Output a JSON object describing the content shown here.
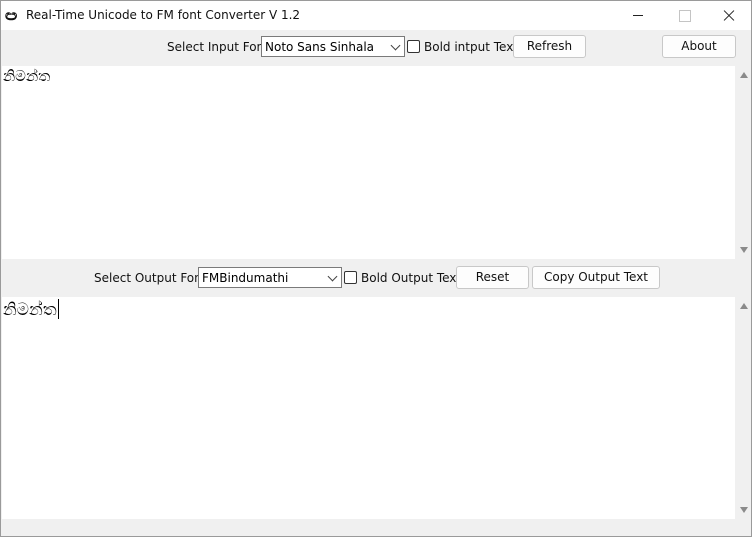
{
  "window": {
    "title": "Real-Time Unicode to FM font Converter V 1.2",
    "icon_glyph": "ඏ"
  },
  "input_bar": {
    "font_label": "Select Input Font",
    "font_selected": "Noto Sans Sinhala",
    "bold_label": "Bold intput Text",
    "bold_checked": false,
    "refresh_label": "Refresh",
    "about_label": "About"
  },
  "input_text": "නිමන්ත",
  "output_bar": {
    "font_label": "Select Output Font",
    "font_selected": "FMBindumathi",
    "bold_label": "Bold Output Text",
    "bold_checked": false,
    "reset_label": "Reset",
    "copy_label": "Copy Output Text"
  },
  "output_text": "නිමන්ත"
}
